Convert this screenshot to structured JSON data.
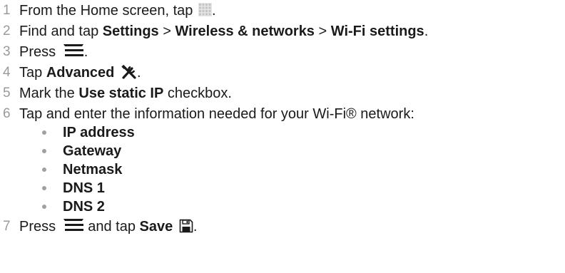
{
  "steps": [
    {
      "num": "1",
      "pre": "From the Home screen, tap",
      "post": "."
    },
    {
      "num": "2",
      "pre": "Find and tap",
      "settings": "Settings",
      "sep1": ">",
      "wireless": "Wireless & networks",
      "sep2": ">",
      "wifi": "Wi-Fi settings",
      "post": "."
    },
    {
      "num": "3",
      "pre": "Press",
      "post": "."
    },
    {
      "num": "4",
      "pre": "Tap",
      "bold": "Advanced",
      "post": "."
    },
    {
      "num": "5",
      "pre": "Mark the",
      "bold": "Use static IP",
      "post": "checkbox."
    },
    {
      "num": "6",
      "text": "Tap and enter the information needed for your Wi-Fi® network:"
    },
    {
      "num": "7",
      "pre": "Press",
      "mid": "and tap",
      "bold": "Save",
      "post": "."
    }
  ],
  "bullets": [
    "IP address",
    "Gateway",
    "Netmask",
    "DNS 1",
    "DNS 2"
  ],
  "icons": {
    "apps": "apps-grid-icon",
    "menu": "menu-icon",
    "advanced": "tools-icon",
    "save": "save-icon"
  },
  "colors": {
    "text": "#1a1a1a",
    "number": "#9a9a9a",
    "bullet": "#a0a0a0"
  }
}
